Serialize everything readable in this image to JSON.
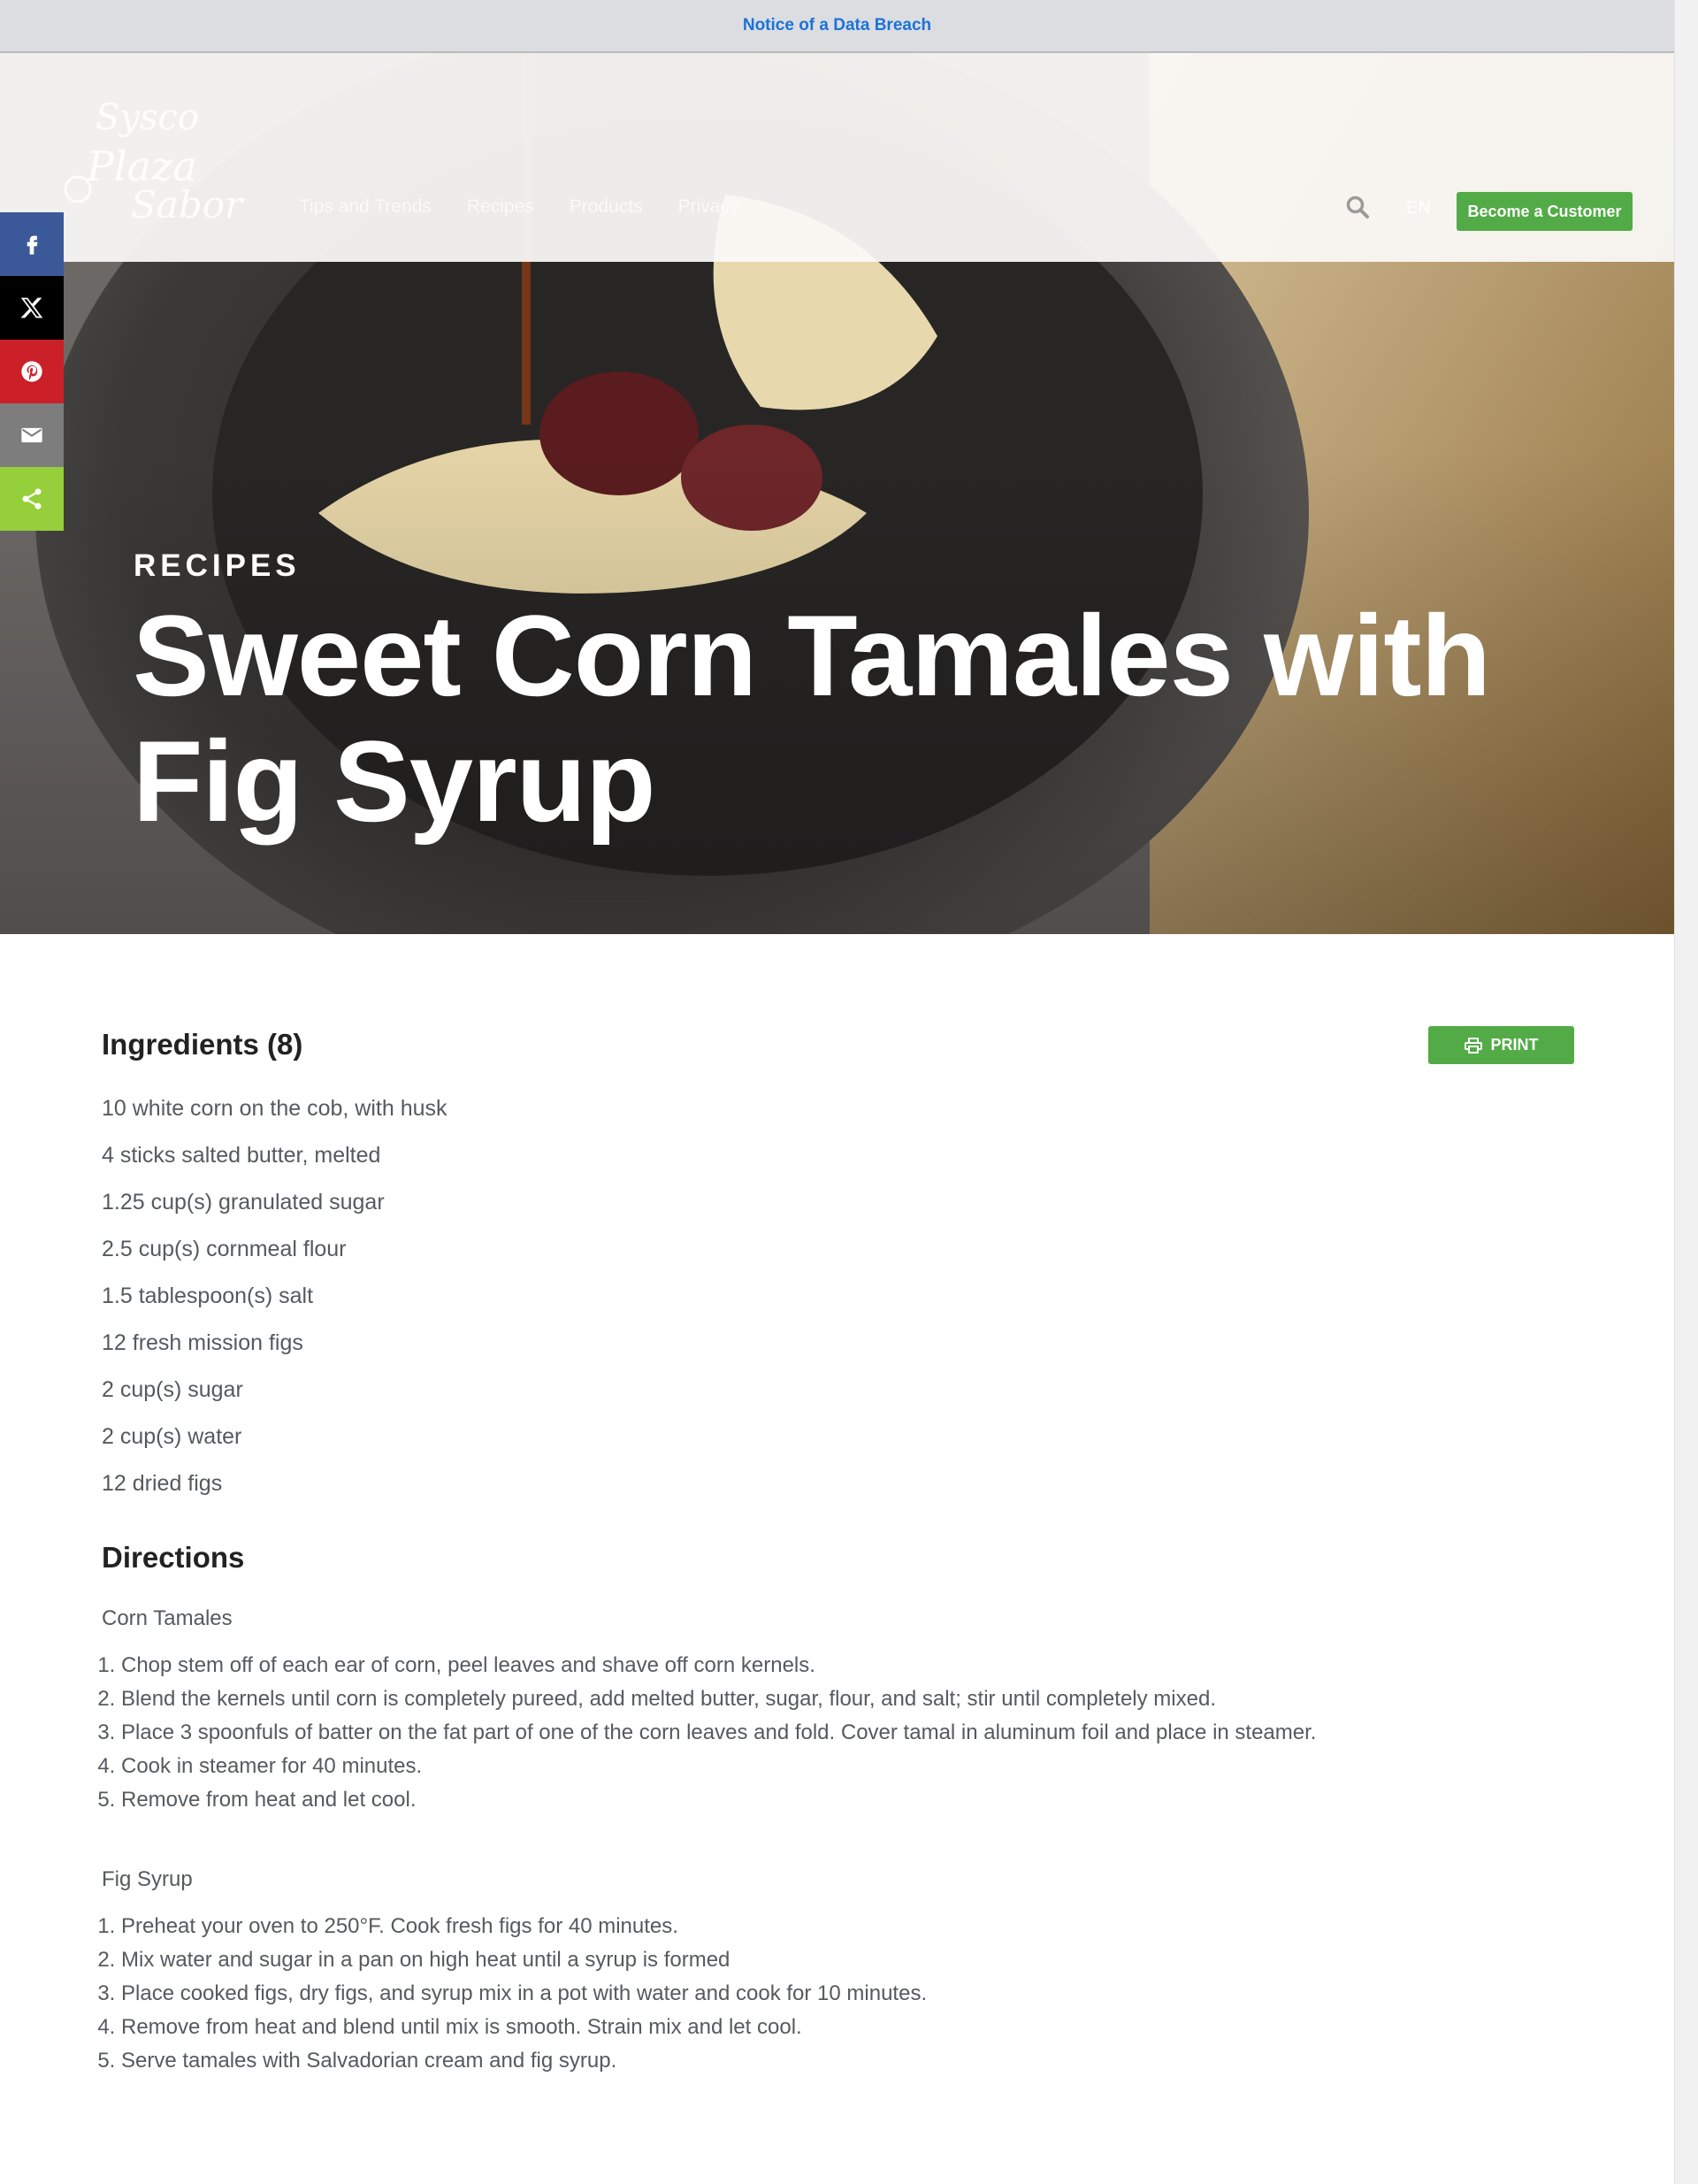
{
  "notice": {
    "label": "Notice of a Data Breach"
  },
  "header": {
    "logo_text": "Sysco Plaza Sabor",
    "nav": [
      "Tips and Trends",
      "Recipes",
      "Products",
      "Privacy"
    ],
    "lang": "EN",
    "cta": "Become a Customer"
  },
  "hero": {
    "kicker": "RECIPES",
    "title": "Sweet Corn Tamales with Fig Syrup"
  },
  "share": [
    {
      "name": "facebook",
      "color": "#3b5998"
    },
    {
      "name": "x",
      "color": "#000000"
    },
    {
      "name": "pinterest",
      "color": "#cb2027"
    },
    {
      "name": "email",
      "color": "#7d7d7d"
    },
    {
      "name": "share",
      "color": "#95d03a"
    }
  ],
  "ingredients": {
    "title": "Ingredients (8)",
    "print_label": "PRINT",
    "items": [
      "10 white corn on the cob, with husk",
      "4 sticks salted butter, melted",
      "1.25 cup(s) granulated sugar",
      "2.5 cup(s) cornmeal flour",
      "1.5 tablespoon(s) salt",
      "12 fresh mission figs",
      "2 cup(s) sugar",
      "2 cup(s) water",
      "12 dried figs"
    ]
  },
  "directions": {
    "title": "Directions",
    "sections": [
      {
        "heading": "Corn Tamales",
        "steps": [
          "Chop stem off of each ear of corn, peel leaves and shave off corn kernels.",
          "Blend the kernels until corn is completely pureed, add melted butter, sugar, flour, and salt; stir until completely mixed.",
          "Place 3 spoonfuls of batter on the fat part of one of the corn leaves and fold. Cover tamal in aluminum foil and place in steamer.",
          "Cook in steamer for 40 minutes.",
          "Remove from heat and let cool."
        ]
      },
      {
        "heading": "Fig Syrup",
        "steps": [
          "Preheat your oven to 250°F. Cook fresh figs for 40 minutes.",
          "Mix water and sugar in a pan on high heat until a syrup is formed",
          "Place cooked figs, dry figs, and syrup mix in a pot with water and cook for 10 minutes.",
          "Remove from heat and blend until mix is smooth. Strain mix and let cool.",
          "Serve tamales with Salvadorian cream and fig syrup."
        ]
      }
    ]
  },
  "colors": {
    "accent": "#52ab46",
    "link": "#1a73d9"
  }
}
